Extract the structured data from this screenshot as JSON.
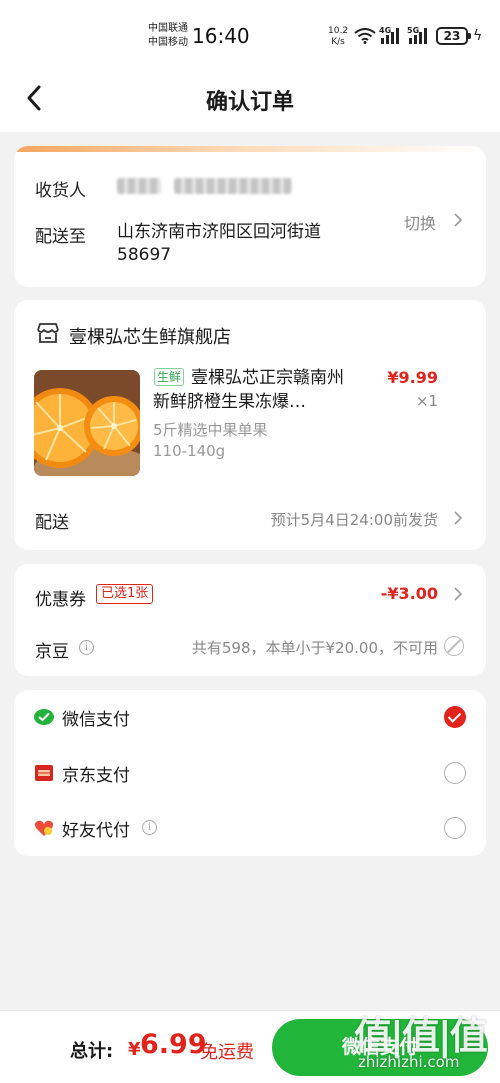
{
  "status_bar": {
    "carrier_1": "中国联通",
    "carrier_2": "中国移动",
    "time": "16:40",
    "net_speed_value": "10.2",
    "net_speed_unit": "K/s",
    "signal_1_gen": "4G",
    "signal_2_gen": "5G",
    "battery": "23"
  },
  "header": {
    "title": "确认订单",
    "back_icon": "chevron-left-icon"
  },
  "address": {
    "receiver_label": "收货人",
    "deliver_to_label": "配送至",
    "address_line_1": "山东济南市济阳区回河街道",
    "address_line_2": "58697",
    "switch_label": "切换"
  },
  "shop": {
    "icon": "store-icon",
    "name": "壹棵弘芯生鲜旗舰店",
    "product": {
      "tag": "生鲜",
      "title": "壹棵弘芯正宗赣南州新鲜脐橙生果冻爆…",
      "price": "¥9.99",
      "quantity": "×1",
      "spec_line_1": "5斤精选中果单果",
      "spec_line_2": "110-140g"
    },
    "shipping_label": "配送",
    "shipping_note": "预计5月4日24:00前发货"
  },
  "promotions": {
    "coupon_label": "优惠券",
    "coupon_badge": "已选1张",
    "coupon_amount": "-¥3.00",
    "beans_label": "京豆",
    "beans_note": "共有598，本单小于¥20.00，不可用"
  },
  "payment": {
    "options": [
      {
        "label": "微信支付",
        "icon": "wechat-pay-icon",
        "selected": true
      },
      {
        "label": "京东支付",
        "icon": "jd-pay-icon",
        "selected": false
      },
      {
        "label": "好友代付",
        "icon": "friend-pay-icon",
        "selected": false
      }
    ]
  },
  "footer": {
    "total_label": "总计:",
    "currency": "¥",
    "total_amount": "6.99",
    "free_shipping": "免运费",
    "pay_button": "微信支付"
  },
  "watermark": {
    "main": "值|值|值",
    "sub": "zhizhizhi.com"
  },
  "colors": {
    "accent_red": "#e2231a",
    "pay_green": "#21b53a",
    "fresh_tag_green": "#2fa84f",
    "page_bg": "#f2f2f2"
  }
}
